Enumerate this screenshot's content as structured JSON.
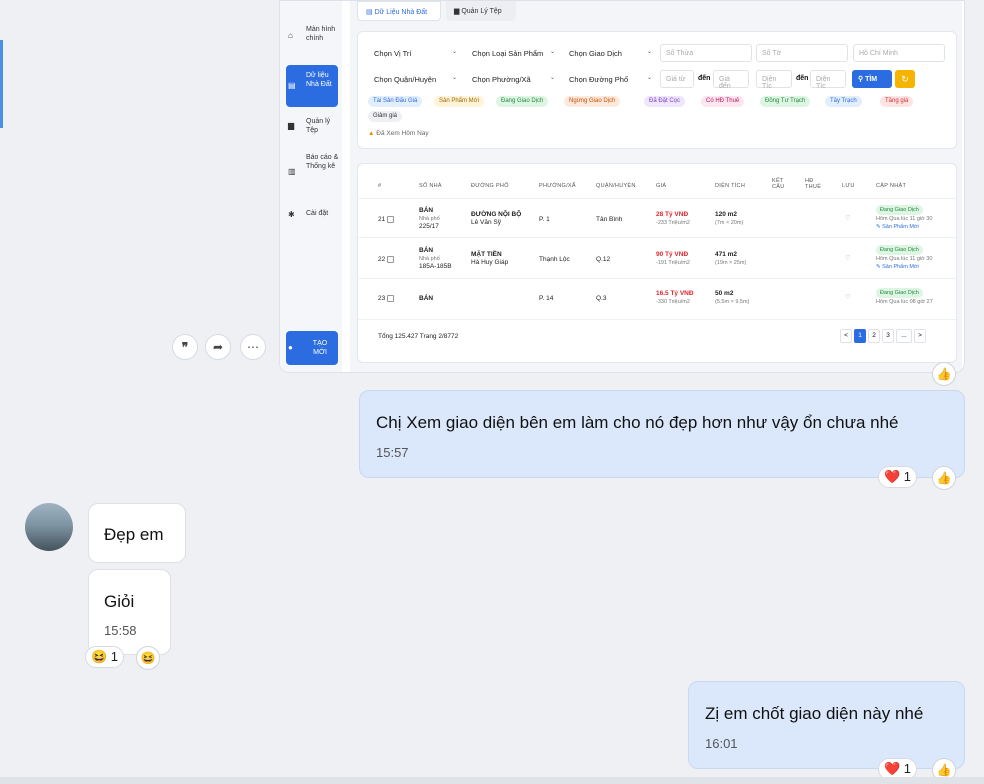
{
  "screenshot": {
    "tabs": [
      "Dữ Liệu Nhà Đất",
      "Quản Lý Tệp"
    ],
    "sidebar": {
      "items": [
        "Màn hình chính",
        "Dữ liệu Nhà Đất",
        "Quản lý Tệp",
        "Báo cáo & Thống kê",
        "Cài đặt"
      ],
      "create_label": "TẠO MỚI"
    },
    "filters": {
      "row1": [
        "Chọn Vị Trí",
        "Chọn Loại Sản Phẩm",
        "Chọn Giao Dịch"
      ],
      "row1_inputs": [
        "Số Thửa",
        "Số Tờ",
        "Hồ Chí Minh"
      ],
      "row2": [
        "Chọn Quận/Huyện",
        "Chọn Phường/Xã",
        "Chọn Đường Phố"
      ],
      "price_from": "Giá từ",
      "price_to": "Giá đến",
      "area_from": "Diện Tíc",
      "area_to": "Diện Tíc",
      "den": "đến",
      "search_button": "TÌM",
      "chips": [
        "Tài Sản Đấu Giá",
        "Sản Phẩm Mới",
        "Đang Giao Dịch",
        "Ngừng Giao Dịch",
        "Đã Đặt Cọc",
        "Có HĐ Thuê",
        "Đồng Tư Trạch",
        "Tây Trạch",
        "Tăng giá",
        "Giảm giá"
      ],
      "seen_today": "Đã Xem Hôm Nay"
    },
    "table": {
      "headers": [
        "#",
        "SỐ NHÀ",
        "ĐƯỜNG PHỐ",
        "PHƯỜNG/XÃ",
        "QUẬN/HUYỆN",
        "GIÁ",
        "DIỆN TÍCH",
        "KẾT CẤU",
        "HĐ THUÊ",
        "LƯU",
        "CẬP NHẬT"
      ],
      "rows": [
        {
          "num": "21",
          "type": "BÁN",
          "kind": "Nhà phố",
          "house": "225/17",
          "street": "ĐƯỜNG NỘI BỘ",
          "street2": "Lê Văn Sỹ",
          "ward": "P. 1",
          "district": "Tân Bình",
          "price": "28 Tỷ VNĐ",
          "ppm": "-233 Triệu/m2",
          "area": "120 m2",
          "dims": "(7m × 20m)",
          "status": "Đang Giao Dịch",
          "updated": "Hôm Qua lúc 11 giờ 30",
          "tag": "Sản Phẩm Mới"
        },
        {
          "num": "22",
          "type": "BÁN",
          "kind": "Nhà phố",
          "house": "185A-185B",
          "street": "MẶT TIỀN",
          "street2": "Hà Huy Giáp",
          "ward": "Thạnh Lộc",
          "district": "Q.12",
          "price": "90 Tỷ VNĐ",
          "ppm": "-191 Triệu/m2",
          "area": "471 m2",
          "dims": "(19m × 25m)",
          "status": "Đang Giao Dịch",
          "updated": "Hôm Qua lúc 11 giờ 30",
          "tag": "Sản Phẩm Mới"
        },
        {
          "num": "23",
          "type": "BÁN",
          "kind": "",
          "house": "",
          "street": "",
          "street2": "",
          "ward": "P. 14",
          "district": "Q.3",
          "price": "16.5 Tỷ VNĐ",
          "ppm": "-330 Triệu/m2",
          "area": "50 m2",
          "dims": "(5.5m × 9.5m)",
          "status": "Đang Giao Dịch",
          "updated": "Hôm Qua lúc 08 giờ 27",
          "tag": ""
        }
      ],
      "footer": "Tổng 125.427 Trang 2/8772",
      "pages": [
        "<",
        "1",
        "2",
        "3",
        "...",
        ">"
      ]
    }
  },
  "messages": {
    "m1_text": "Chị Xem giao diện bên em làm cho nó đẹp hơn như vậy ổn chưa nhé",
    "m1_time": "15:57",
    "m1_react": "❤️ 1",
    "m2_text": "Đẹp em",
    "m3_text": "Giỏi",
    "m3_time": "15:58",
    "m3_react": "😆 1",
    "m4_text": "Zị em chốt giao diện này nhé",
    "m4_time": "16:01",
    "m4_react": "❤️ 1"
  },
  "icons": {
    "quote": "quote-icon",
    "share": "share-icon",
    "more": "more-icon",
    "like": "thumbs-up-icon"
  },
  "colors": {
    "accent": "#2b6de0",
    "bubble_out": "#dbe8fb",
    "price": "#e0262d"
  }
}
